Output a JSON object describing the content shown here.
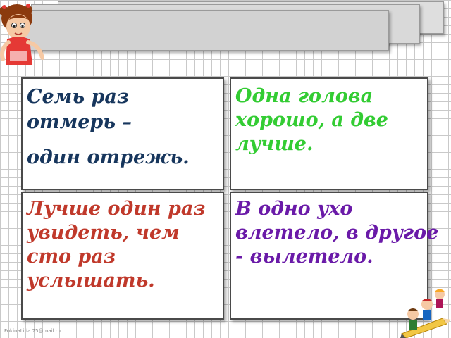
{
  "cards": {
    "top_left": {
      "lines": [
        "Семь раз",
        "отмерь –",
        "один отрежь."
      ],
      "color": "#17365d"
    },
    "top_right": {
      "lines": [
        "Одна голова",
        "хорошо, а две",
        "лучше."
      ],
      "color": "#33cc33"
    },
    "bottom_left": {
      "lines": [
        "Лучше один раз",
        "увидеть, чем",
        "сто раз",
        "услышать."
      ],
      "color": "#c0392b"
    },
    "bottom_right": {
      "lines": [
        "В одно ухо",
        "влетело, в другое",
        "- вылетело."
      ],
      "color": "#6a1aa8"
    }
  },
  "credit": "FokinaLida.75@mail.ru",
  "decorations": {
    "top_left": "girl-clipart",
    "bottom_right": "children-on-pencil-clipart"
  }
}
